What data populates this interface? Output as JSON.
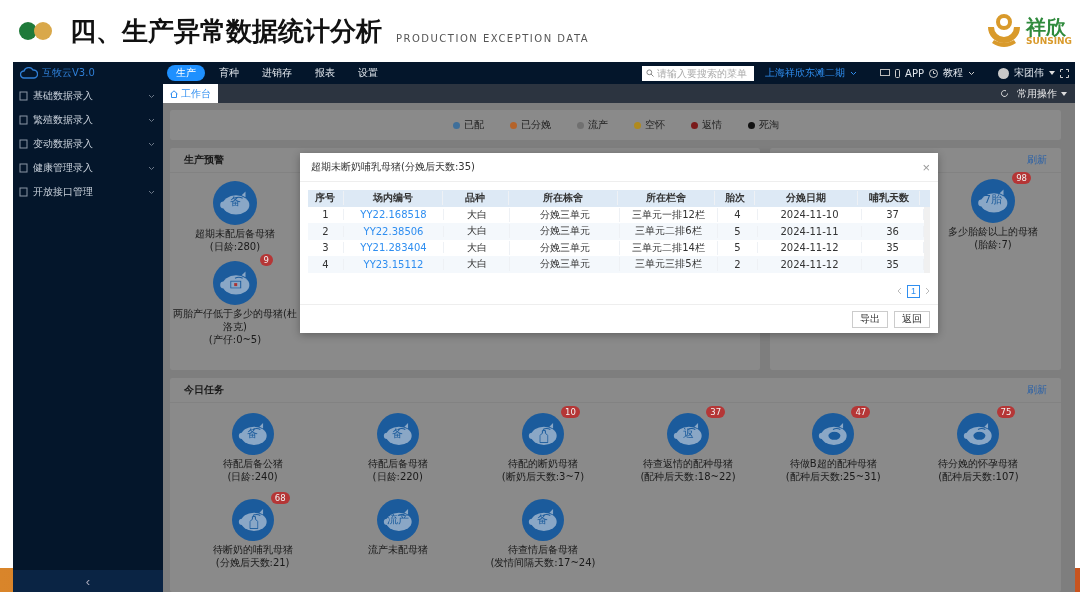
{
  "slide": {
    "title": "四、生产异常数据统计分析",
    "subtitle": "PRODUCTION EXCEPTION DATA",
    "logo_text": "祥欣",
    "logo_subtext": "SUNSING"
  },
  "app": {
    "brand": "互牧云V3.0",
    "sidebar": {
      "items": [
        {
          "label": "基础数据录入"
        },
        {
          "label": "繁殖数据录入"
        },
        {
          "label": "变动数据录入"
        },
        {
          "label": "健康管理录入"
        },
        {
          "label": "开放接口管理"
        }
      ],
      "collapse": "‹"
    },
    "nav": [
      {
        "label": "生产",
        "selected": true
      },
      {
        "label": "育种",
        "selected": false
      },
      {
        "label": "进销存",
        "selected": false
      },
      {
        "label": "报表",
        "selected": false
      },
      {
        "label": "设置",
        "selected": false
      }
    ],
    "search": {
      "placeholder": "请输入要搜索的菜单"
    },
    "farm": "上海祥欣东滩二期",
    "app_link": "APP",
    "tutorial": "教程",
    "user": "宋团伟"
  },
  "tab_bar": {
    "tabs": [
      {
        "label": "工作台",
        "selected": true
      }
    ],
    "common_ops": "常用操作"
  },
  "legend": [
    {
      "label": "已配",
      "color": "#3f6f9a"
    },
    {
      "label": "已分娩",
      "color": "#b4632a"
    },
    {
      "label": "流产",
      "color": "#707070"
    },
    {
      "label": "空怀",
      "color": "#b08a1e"
    },
    {
      "label": "返情",
      "color": "#7a1a1a"
    },
    {
      "label": "死淘",
      "color": "#111111"
    }
  ],
  "production_warning": {
    "title": "生产预警",
    "items": [
      {
        "label": "超期未配后备母猪",
        "sub": "(日龄:280)",
        "kind": "glyph",
        "glyph": "备"
      },
      {
        "label": "两胎产仔低于多少的母猪(杜洛克)",
        "sub": "(产仔:0~5)",
        "kind": "battery",
        "badge": "9"
      }
    ]
  },
  "warning_right": {
    "refresh": "刷新",
    "items": [
      {
        "label": "多少胎龄以上的母猪",
        "sub": "(胎龄:7)",
        "kind": "glyph",
        "glyph": "7胎",
        "badge": "98"
      }
    ]
  },
  "today_tasks": {
    "title": "今日任务",
    "refresh": "刷新",
    "items": [
      {
        "label": "待配后备公猪",
        "sub": "(日龄:240)",
        "kind": "glyph",
        "glyph": "备"
      },
      {
        "label": "待配后备母猪",
        "sub": "(日龄:220)",
        "kind": "glyph",
        "glyph": "备"
      },
      {
        "label": "待配的断奶母猪",
        "sub": "(断奶后天数:3~7)",
        "kind": "bottle",
        "badge": "10"
      },
      {
        "label": "待查返情的配种母猪",
        "sub": "(配种后天数:18~22)",
        "kind": "glyph",
        "glyph": "返",
        "badge": "37"
      },
      {
        "label": "待做B超的配种母猪",
        "sub": "(配种后天数:25~31)",
        "kind": "pig",
        "badge": "47"
      },
      {
        "label": "待分娩的怀孕母猪",
        "sub": "(配种后天数:107)",
        "kind": "pig",
        "badge": "75"
      },
      {
        "label": "待断奶的哺乳母猪",
        "sub": "(分娩后天数:21)",
        "kind": "bottle",
        "badge": "68"
      },
      {
        "label": "流产未配母猪",
        "kind": "glyph",
        "glyph": "流产"
      },
      {
        "label": "待查情后备母猪",
        "sub": "(发情间隔天数:17~24)",
        "kind": "glyph",
        "glyph": "备"
      }
    ]
  },
  "dialog": {
    "title": "超期未断奶哺乳母猪(分娩后天数:35)",
    "close": "×",
    "columns": [
      "序号",
      "场内编号",
      "品种",
      "所在栋舍",
      "所在栏舍",
      "胎次",
      "分娩日期",
      "哺乳天数"
    ],
    "rows": [
      [
        "1",
        "YY22.168518",
        "大白",
        "分娩三单元",
        "三单元一排12栏",
        "4",
        "2024-11-10",
        "37"
      ],
      [
        "2",
        "YY22.38506",
        "大白",
        "分娩三单元",
        "三单元二排6栏",
        "5",
        "2024-11-11",
        "36"
      ],
      [
        "3",
        "YY21.283404",
        "大白",
        "分娩三单元",
        "三单元二排14栏",
        "5",
        "2024-11-12",
        "35"
      ],
      [
        "4",
        "YY23.15112",
        "大白",
        "分娩三单元",
        "三单元三排5栏",
        "2",
        "2024-11-12",
        "35"
      ]
    ],
    "page": "1",
    "buttons": [
      "导出",
      "返回"
    ]
  }
}
